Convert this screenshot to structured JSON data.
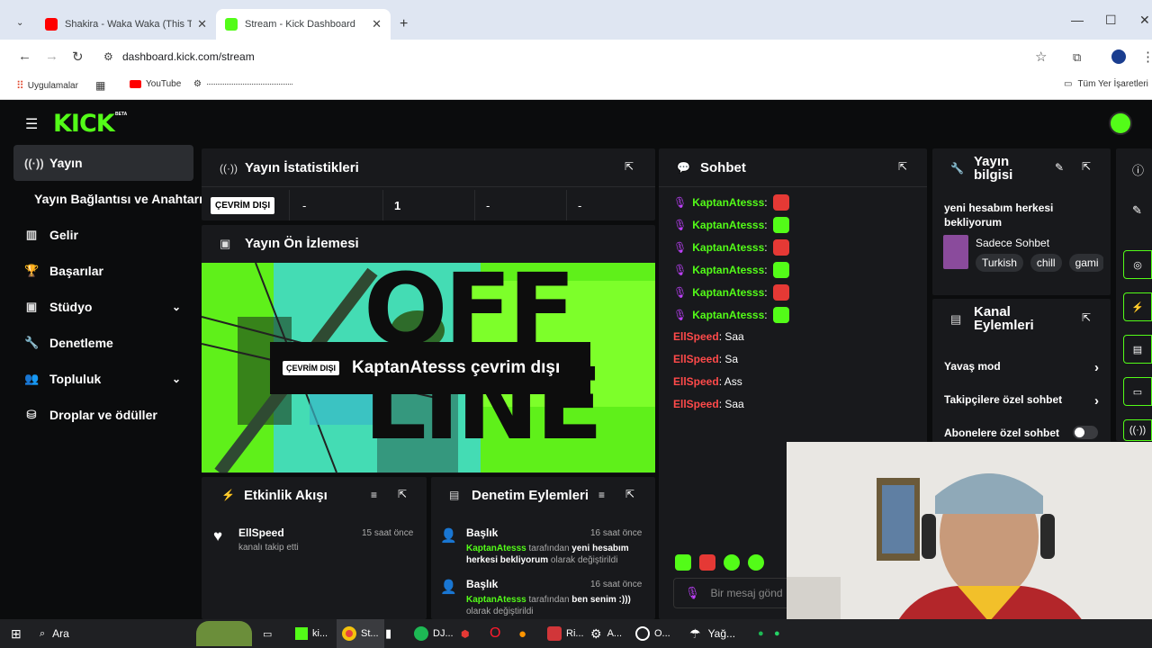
{
  "browser": {
    "tabs": [
      {
        "title": "Shakira - Waka Waka (This Time",
        "active": false
      },
      {
        "title": "Stream - Kick Dashboard",
        "active": true
      }
    ],
    "new_tab": "+",
    "url": "dashboard.kick.com/stream",
    "bookmarks": {
      "apps": "Uygulamalar",
      "youtube": "YouTube",
      "all": "Tüm Yer İşaretleri"
    }
  },
  "header": {
    "logo": "KICK",
    "beta": "BETA"
  },
  "sidebar": {
    "items": [
      {
        "label": "Yayın"
      },
      {
        "label": "Yayın Bağlantısı ve Anahtarı"
      },
      {
        "label": "Gelir"
      },
      {
        "label": "Başarılar"
      },
      {
        "label": "Stüdyo"
      },
      {
        "label": "Denetleme"
      },
      {
        "label": "Topluluk"
      },
      {
        "label": "Droplar ve ödüller"
      }
    ]
  },
  "stats": {
    "title": "Yayın İstatistikleri",
    "status": "ÇEVRİM DIŞI",
    "cells": [
      "-",
      "1",
      "-",
      "-"
    ]
  },
  "preview": {
    "title": "Yayın Ön İzlemesi",
    "badge": "ÇEVRİM DIŞI",
    "message": "KaptanAtesss çevrim dışı",
    "bg_text": "OFF LINE"
  },
  "chat": {
    "title": "Sohbet",
    "messages": [
      {
        "user": "KaptanAtesss",
        "text": ":",
        "emote": "red"
      },
      {
        "user": "KaptanAtesss",
        "text": ":",
        "emote": "green"
      },
      {
        "user": "KaptanAtesss",
        "text": ":",
        "emote": "red"
      },
      {
        "user": "KaptanAtesss",
        "text": ":",
        "emote": "green"
      },
      {
        "user": "KaptanAtesss",
        "text": ":",
        "emote": "red"
      },
      {
        "user": "KaptanAtesss",
        "text": ":",
        "emote": "green"
      },
      {
        "user": "EllSpeed",
        "text": ": Saa"
      },
      {
        "user": "EllSpeed",
        "text": ": Sa"
      },
      {
        "user": "EllSpeed",
        "text": ": Ass"
      },
      {
        "user": "EllSpeed",
        "text": ": Saa"
      }
    ],
    "input_placeholder": "Bir mesaj gönd"
  },
  "stream_info": {
    "title1": "Yayın",
    "title2": "bilgisi",
    "stream_title": "yeni hesabım herkesi bekliyorum",
    "category": "Sadece Sohbet",
    "tags": [
      "Turkish",
      "chill",
      "gami"
    ]
  },
  "channel_actions": {
    "title1": "Kanal",
    "title2": "Eylemleri",
    "items": [
      "Yavaş mod",
      "Takipçilere özel sohbet",
      "Abonelere özel sohbet"
    ]
  },
  "activity": {
    "title": "Etkinlik Akışı",
    "items": [
      {
        "user": "EllSpeed",
        "action": "kanalı takip etti",
        "time": "15 saat önce"
      }
    ]
  },
  "moderation": {
    "title": "Denetim Eylemleri",
    "items": [
      {
        "heading": "Başlık",
        "time": "16 saat önce",
        "user": "KaptanAtesss",
        "mid": " tarafından ",
        "value": "yeni hesabım herkesi bekliyorum",
        "tail": " olarak değiştirildi"
      },
      {
        "heading": "Başlık",
        "time": "16 saat önce",
        "user": "KaptanAtesss",
        "mid": " tarafından ",
        "value": "ben senim :)))",
        "tail": " olarak değiştirildi"
      }
    ]
  },
  "taskbar": {
    "search": "Ara",
    "items": [
      "ki...",
      "St...",
      "DJ...",
      "Ri...",
      "A...",
      "O..."
    ],
    "weather": "Yağ..."
  }
}
